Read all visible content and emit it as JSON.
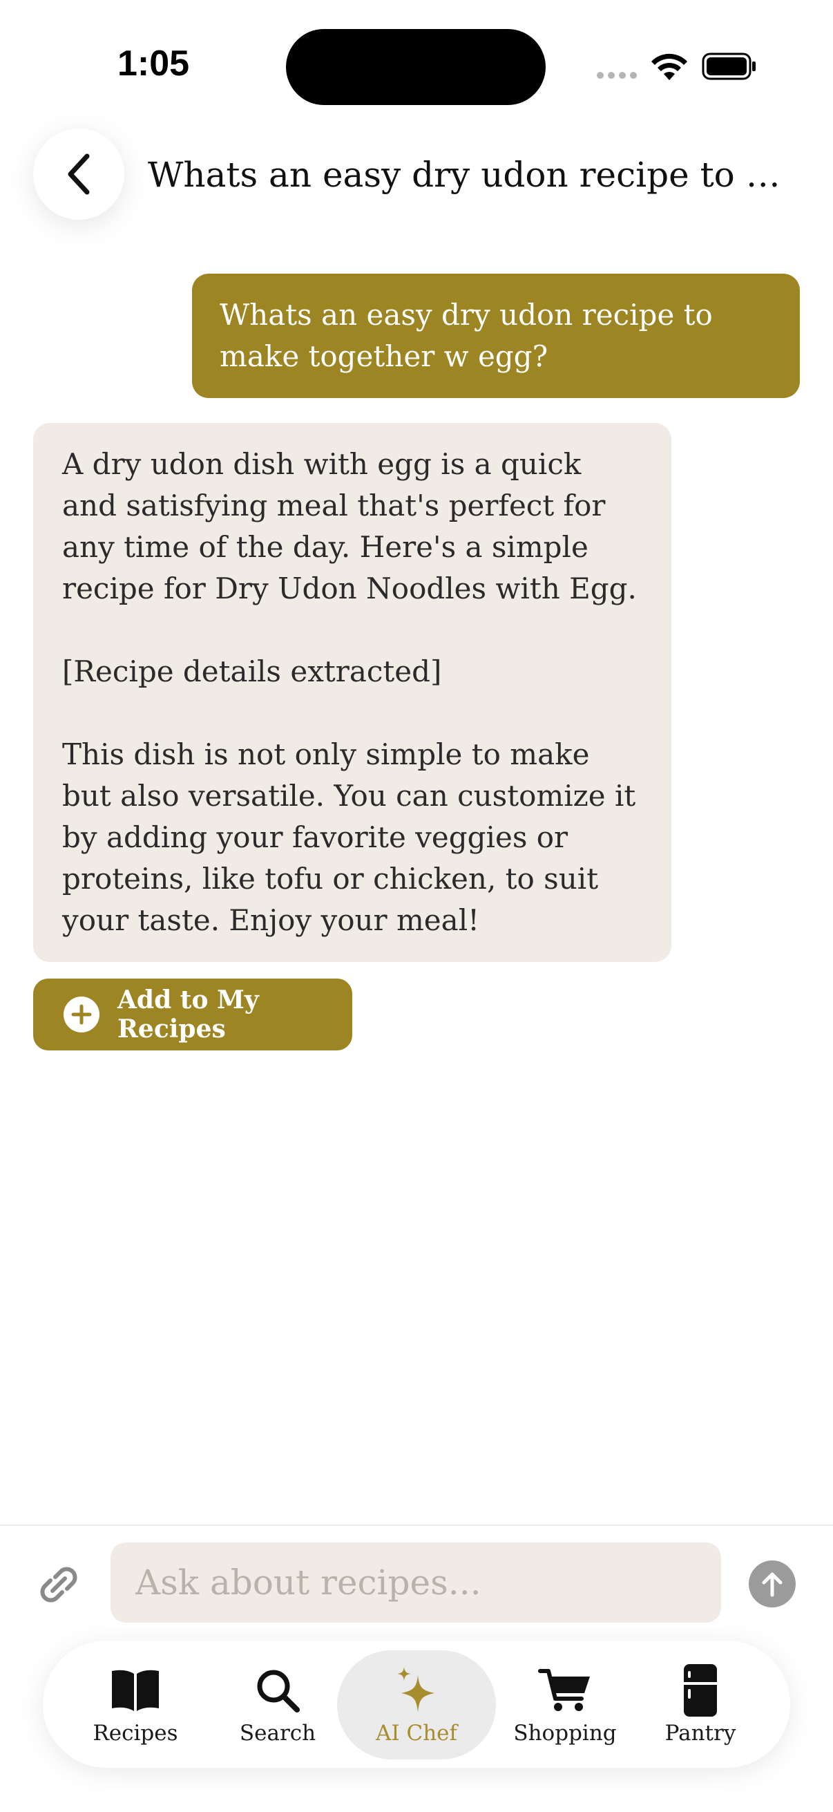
{
  "status_bar": {
    "time": "1:05"
  },
  "header": {
    "title": "Whats an easy dry udon recipe to make together w egg?",
    "back_icon": "chevron-left-icon"
  },
  "messages": {
    "user": "Whats an easy dry udon recipe to make together w egg?",
    "assistant": {
      "paragraphs": [
        "A dry udon dish with egg is a quick and satisfying meal that's perfect for any time of the day. Here's a simple recipe for Dry Udon Noodles with Egg.",
        "[Recipe details extracted]",
        "This dish is not only simple to make but also versatile. You can customize it by adding your favorite veggies or proteins, like tofu or chicken, to suit your taste. Enjoy your meal!"
      ]
    },
    "add_button_label": "Add to My Recipes"
  },
  "composer": {
    "placeholder": "Ask about recipes...",
    "value": ""
  },
  "tabs": [
    {
      "label": "Recipes",
      "icon": "book-icon"
    },
    {
      "label": "Search",
      "icon": "search-icon"
    },
    {
      "label": "AI Chef",
      "icon": "sparkles-icon"
    },
    {
      "label": "Shopping",
      "icon": "cart-icon"
    },
    {
      "label": "Pantry",
      "icon": "fridge-icon"
    }
  ],
  "colors": {
    "accent": "#9c8522",
    "active_tab_label": "#a88d2e",
    "assistant_bubble": "#f0ebe5",
    "input_background": "#f0ebe5"
  }
}
